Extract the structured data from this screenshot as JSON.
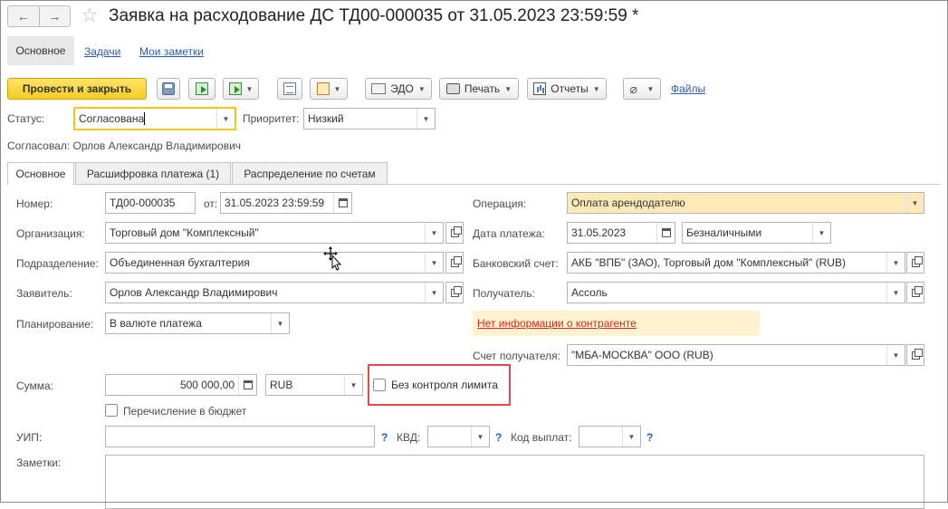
{
  "header": {
    "back_icon": "←",
    "forward_icon": "→",
    "star_icon": "☆",
    "title": "Заявка на расходование ДС ТД00-000035 от 31.05.2023 23:59:59 *"
  },
  "top_tabs": {
    "main": "Основное",
    "tasks": "Задачи",
    "notes": "Мои заметки"
  },
  "toolbar": {
    "post_close": "Провести и закрыть",
    "edo": "ЭДО",
    "print": "Печать",
    "reports": "Отчеты",
    "files": "Файлы"
  },
  "status": {
    "label": "Статус:",
    "value": "Согласована",
    "priority_label": "Приоритет:",
    "priority_value": "Низкий",
    "approved_by": "Согласовал: Орлов Александр Владимирович"
  },
  "inner_tabs": [
    "Основное",
    "Расшифровка платежа (1)",
    "Распределение по счетам"
  ],
  "form": {
    "number_label": "Номер:",
    "number": "ТД00-000035",
    "from_label": "от:",
    "date": "31.05.2023 23:59:59",
    "org_label": "Организация:",
    "org": "Торговый дом \"Комплексный\"",
    "dept_label": "Подразделение:",
    "dept": "Объединенная бухгалтерия",
    "applicant_label": "Заявитель:",
    "applicant": "Орлов Александр Владимирович",
    "planning_label": "Планирование:",
    "planning": "В валюте платежа",
    "operation_label": "Операция:",
    "operation": "Оплата арендодателю",
    "pay_date_label": "Дата платежа:",
    "pay_date": "31.05.2023",
    "pay_type": "Безналичными",
    "bank_label": "Банковский счет:",
    "bank": "АКБ \"ВПБ\" (ЗАО), Торговый дом \"Комплексный\" (RUB)",
    "recipient_label": "Получатель:",
    "recipient": "Ассоль",
    "no_info": "Нет информации о контрагенте",
    "recipient_account_label": "Счет получателя:",
    "recipient_account": "\"МБА-МОСКВА\" ООО (RUB)",
    "sum_label": "Сумма:",
    "sum": "500 000,00",
    "currency": "RUB",
    "no_limit": "Без контроля лимита",
    "budget": "Перечисление в бюджет",
    "uip_label": "УИП:",
    "kvd_label": "КВД:",
    "code_label": "Код выплат:",
    "question": "?",
    "notes_label": "Заметки:"
  },
  "colors": {
    "primary_button": "#f4cc21",
    "operation_field": "#fde9b8",
    "warning_bg": "#fdf3d0",
    "warning_link": "#d9261c",
    "highlight_frame": "#e14b4b",
    "link": "#2a5cb0"
  }
}
